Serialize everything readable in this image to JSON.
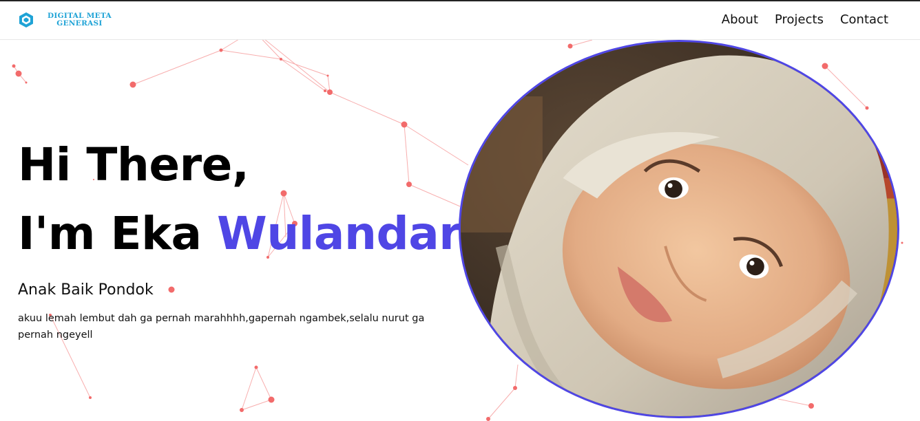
{
  "brand": {
    "icon": "hexagon-logo-icon",
    "line1": "DIGITAL META",
    "line2": "GENERASI",
    "color": "#1fa3d6"
  },
  "nav": {
    "items": [
      {
        "label": "About"
      },
      {
        "label": "Projects"
      },
      {
        "label": "Contact"
      }
    ]
  },
  "hero": {
    "line1": "Hi There,",
    "line2_prefix": "I'm Eka ",
    "line2_accent": "Wulandari",
    "subtitle": "Anak Baik Pondok",
    "description": "akuu lemah lembut dah ga pernah marahhhh,gapernah ngambek,selalu nurut ga pernah ngeyell",
    "accent_color": "#4f46e5"
  },
  "photo": {
    "border_color": "#4f46e5"
  },
  "colors": {
    "particles": "#f26b6b"
  }
}
